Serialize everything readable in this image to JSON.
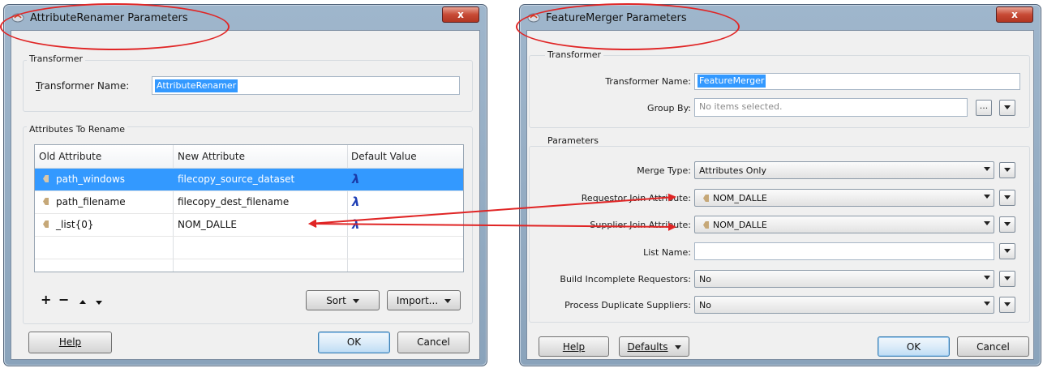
{
  "left_dialog": {
    "title": "AttributeRenamer Parameters",
    "close_label": "x",
    "transformer_group": "Transformer",
    "name_label_prefix": "T",
    "name_label_rest": "ransformer Name:",
    "name_value": "AttributeRenamer",
    "attributes_group": "Attributes To Rename",
    "columns": [
      "Old Attribute",
      "New Attribute",
      "Default Value"
    ],
    "rows": [
      {
        "old": "path_windows",
        "new": "filecopy_source_dataset",
        "default_icon": "λ"
      },
      {
        "old": "path_filename",
        "new": "filecopy_dest_filename",
        "default_icon": "λ"
      },
      {
        "old": "_list{0}",
        "new": "NOM_DALLE",
        "default_icon": "λ"
      }
    ],
    "tools": {
      "add": "+",
      "remove": "−"
    },
    "sort_label": "Sort",
    "import_label": "Import...",
    "help_label": "Help",
    "ok_label": "OK",
    "cancel_label": "Cancel"
  },
  "right_dialog": {
    "title": "FeatureMerger Parameters",
    "close_label": "x",
    "transformer_group": "Transformer",
    "name_label": "Transformer Name:",
    "name_value": "FeatureMerger",
    "group_by_label": "Group By:",
    "group_by_placeholder": "No items selected.",
    "group_by_button": "...",
    "parameters_group": "Parameters",
    "params": [
      {
        "label": "Merge Type:",
        "value": "Attributes Only",
        "has_tag": false
      },
      {
        "label": "Requestor Join Attribute:",
        "value": "NOM_DALLE",
        "has_tag": true
      },
      {
        "label": "Supplier Join Attribute:",
        "value": "NOM_DALLE",
        "has_tag": true
      },
      {
        "label": "List Name:",
        "value": "",
        "has_tag": false
      },
      {
        "label": "Build Incomplete Requestors:",
        "value": "No",
        "has_tag": false
      },
      {
        "label": "Process Duplicate Suppliers:",
        "value": "No",
        "has_tag": false
      }
    ],
    "help_label": "Help",
    "defaults_label": "Defaults",
    "ok_label": "OK",
    "cancel_label": "Cancel"
  },
  "annotation_color": "#e02525"
}
